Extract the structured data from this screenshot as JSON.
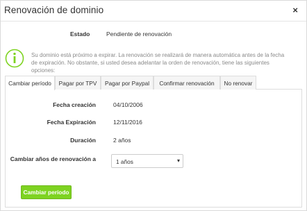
{
  "dialog": {
    "title": "Renovación de dominio",
    "close_glyph": "×"
  },
  "status": {
    "label": "Estado",
    "value": "Pendiente de renovación"
  },
  "info": {
    "icon": "info-icon",
    "accent_color": "#7ed321",
    "message": "Su dominio está próximo a expirar. La renovación se realizará de manera automática antes de la fecha de expiración. No obstante, si usted desea adelantar la orden de renovación, tiene las siguientes opciones:"
  },
  "tabs": [
    {
      "label": "Cambiar período",
      "active": true
    },
    {
      "label": "Pagar por TPV",
      "active": false
    },
    {
      "label": "Pagar por Paypal",
      "active": false
    },
    {
      "label": "Confirmar renovación",
      "active": false
    },
    {
      "label": "No renovar",
      "active": false
    }
  ],
  "details": {
    "creation_label": "Fecha creación",
    "creation_value": "04/10/2006",
    "expiration_label": "Fecha Expiración",
    "expiration_value": "12/11/2016",
    "duration_label": "Duración",
    "duration_value": "2 años",
    "renewal_years_label": "Cambiar años de renovación a",
    "renewal_years_selected": "1 años",
    "caret_icon": "chevron-down-icon"
  },
  "actions": {
    "submit_label": "Cambiar período",
    "submit_color": "#7ed321"
  }
}
